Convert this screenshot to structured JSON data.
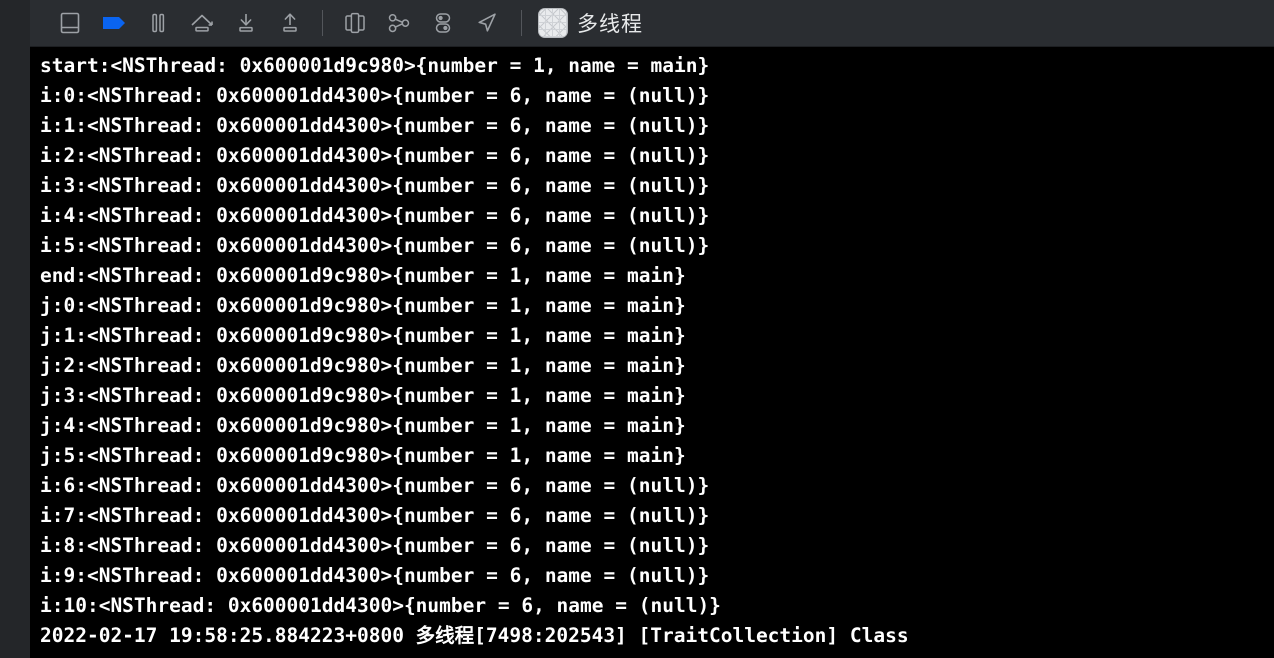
{
  "window": {
    "title": "多线程",
    "app_icon": "grid-app-icon"
  },
  "toolbar": {
    "background_color": "#2a2d31",
    "accent_color": "#0a64f0",
    "icon_color": "#9da1a6",
    "buttons": [
      {
        "name": "toggle-debug-area-button",
        "icon": "panel-bottom-icon",
        "label": "Hide or show the Debug area"
      },
      {
        "name": "continue-button",
        "icon": "continue-play-icon",
        "label": "Continue program execution",
        "active": true
      },
      {
        "name": "pause-button",
        "icon": "pause-icon",
        "label": "Pause program execution"
      },
      {
        "name": "step-over-button",
        "icon": "step-over-icon",
        "label": "Step over"
      },
      {
        "name": "step-into-button",
        "icon": "step-into-icon",
        "label": "Step into"
      },
      {
        "name": "step-out-button",
        "icon": "step-out-icon",
        "label": "Step out"
      },
      {
        "name": "view-debugging-button",
        "icon": "view-debug-icon",
        "label": "Debug View Hierarchy"
      },
      {
        "name": "memory-graph-button",
        "icon": "memory-graph-icon",
        "label": "Debug Memory Graph"
      },
      {
        "name": "environment-overrides-button",
        "icon": "environment-overrides-icon",
        "label": "Environment Overrides"
      },
      {
        "name": "simulate-location-button",
        "icon": "location-arrow-icon",
        "label": "Simulate Location"
      }
    ]
  },
  "console": {
    "background_color": "#000000",
    "text_color": "#ffffff",
    "lines": [
      "start:<NSThread: 0x600001d9c980>{number = 1, name = main}",
      "i:0:<NSThread: 0x600001dd4300>{number = 6, name = (null)}",
      "i:1:<NSThread: 0x600001dd4300>{number = 6, name = (null)}",
      "i:2:<NSThread: 0x600001dd4300>{number = 6, name = (null)}",
      "i:3:<NSThread: 0x600001dd4300>{number = 6, name = (null)}",
      "i:4:<NSThread: 0x600001dd4300>{number = 6, name = (null)}",
      "i:5:<NSThread: 0x600001dd4300>{number = 6, name = (null)}",
      "end:<NSThread: 0x600001d9c980>{number = 1, name = main}",
      "j:0:<NSThread: 0x600001d9c980>{number = 1, name = main}",
      "j:1:<NSThread: 0x600001d9c980>{number = 1, name = main}",
      "j:2:<NSThread: 0x600001d9c980>{number = 1, name = main}",
      "j:3:<NSThread: 0x600001d9c980>{number = 1, name = main}",
      "j:4:<NSThread: 0x600001d9c980>{number = 1, name = main}",
      "j:5:<NSThread: 0x600001d9c980>{number = 1, name = main}",
      "i:6:<NSThread: 0x600001dd4300>{number = 6, name = (null)}",
      "i:7:<NSThread: 0x600001dd4300>{number = 6, name = (null)}",
      "i:8:<NSThread: 0x600001dd4300>{number = 6, name = (null)}",
      "i:9:<NSThread: 0x600001dd4300>{number = 6, name = (null)}",
      "i:10:<NSThread: 0x600001dd4300>{number = 6, name = (null)}",
      "2022-02-17 19:58:25.884223+0800 多线程[7498:202543] [TraitCollection] Class"
    ]
  }
}
